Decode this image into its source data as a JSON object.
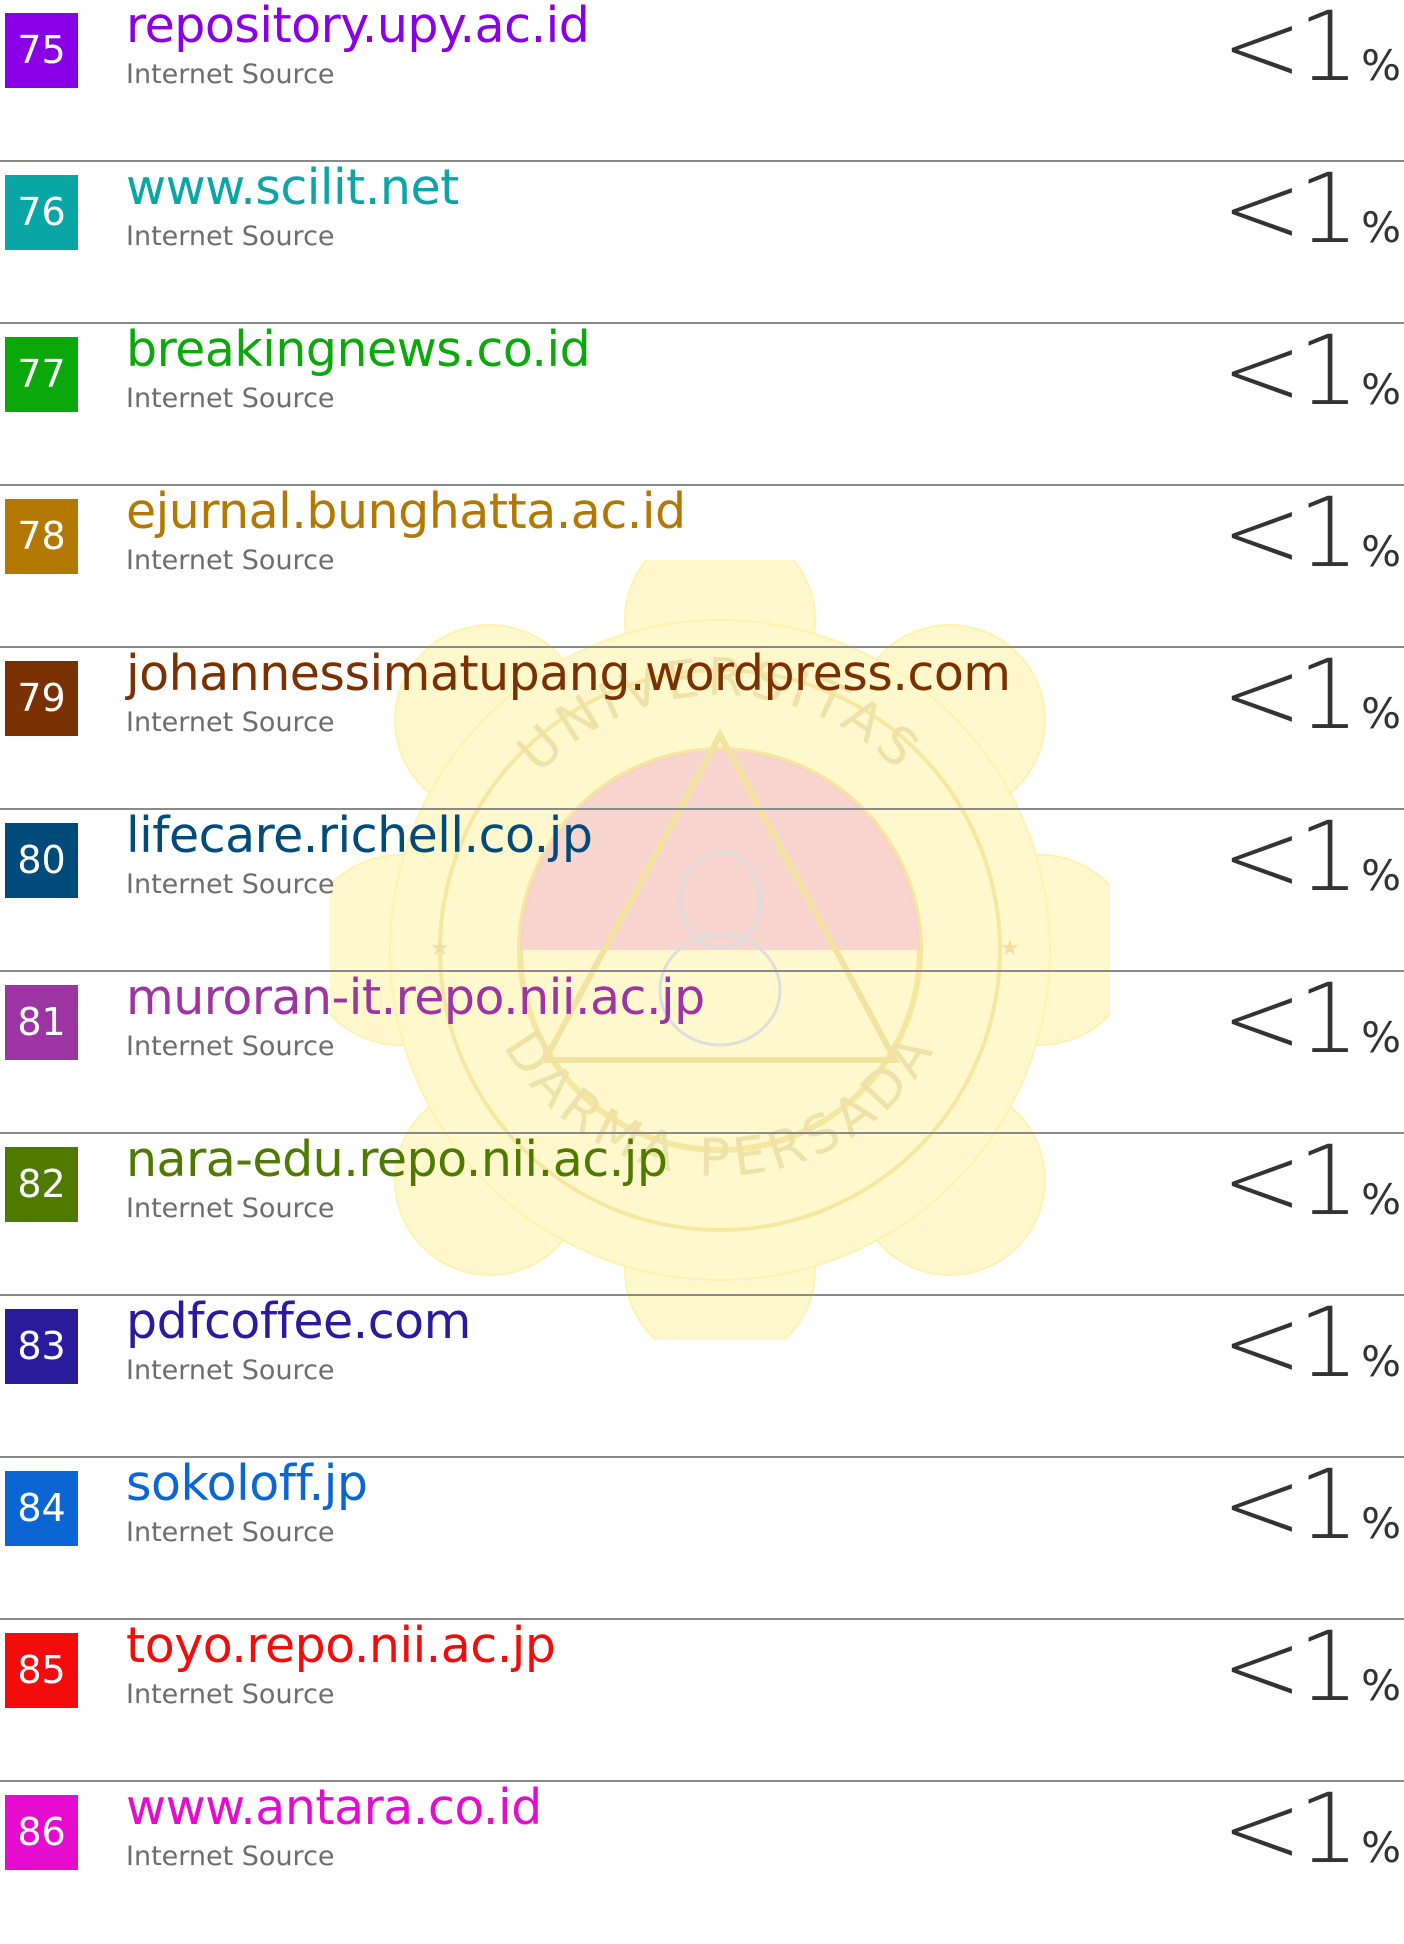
{
  "colors": {
    "divider": "#8a8a8a",
    "source_type": "#6d6d6d",
    "percent": "#333333",
    "watermark": "#fff4b0",
    "watermark_red": "#f7c8c8"
  },
  "watermark": {
    "institution_top": "UNIVERSITAS",
    "institution_bottom": "DARMA PERSADA"
  },
  "sources": [
    {
      "number": "75",
      "domain": "repository.upy.ac.id",
      "type": "Internet Source",
      "percent": "<1",
      "unit": "%",
      "color": "#8a00e6"
    },
    {
      "number": "76",
      "domain": "www.scilit.net",
      "type": "Internet Source",
      "percent": "<1",
      "unit": "%",
      "color": "#0aa5a5"
    },
    {
      "number": "77",
      "domain": "breakingnews.co.id",
      "type": "Internet Source",
      "percent": "<1",
      "unit": "%",
      "color": "#0aa80a"
    },
    {
      "number": "78",
      "domain": "ejurnal.bunghatta.ac.id",
      "type": "Internet Source",
      "percent": "<1",
      "unit": "%",
      "color": "#b27800"
    },
    {
      "number": "79",
      "domain": "johannessimatupang.wordpress.com",
      "type": "Internet Source",
      "percent": "<1",
      "unit": "%",
      "color": "#7a3000"
    },
    {
      "number": "80",
      "domain": "lifecare.richell.co.jp",
      "type": "Internet Source",
      "percent": "<1",
      "unit": "%",
      "color": "#004b7a"
    },
    {
      "number": "81",
      "domain": "muroran-it.repo.nii.ac.jp",
      "type": "Internet Source",
      "percent": "<1",
      "unit": "%",
      "color": "#9c35a3"
    },
    {
      "number": "82",
      "domain": "nara-edu.repo.nii.ac.jp",
      "type": "Internet Source",
      "percent": "<1",
      "unit": "%",
      "color": "#4e7a00"
    },
    {
      "number": "83",
      "domain": "pdfcoffee.com",
      "type": "Internet Source",
      "percent": "<1",
      "unit": "%",
      "color": "#2a1a9c"
    },
    {
      "number": "84",
      "domain": "sokoloff.jp",
      "type": "Internet Source",
      "percent": "<1",
      "unit": "%",
      "color": "#0b66d4"
    },
    {
      "number": "85",
      "domain": "toyo.repo.nii.ac.jp",
      "type": "Internet Source",
      "percent": "<1",
      "unit": "%",
      "color": "#f20c0c"
    },
    {
      "number": "86",
      "domain": "www.antara.co.id",
      "type": "Internet Source",
      "percent": "<1",
      "unit": "%",
      "color": "#e60ccf"
    }
  ]
}
